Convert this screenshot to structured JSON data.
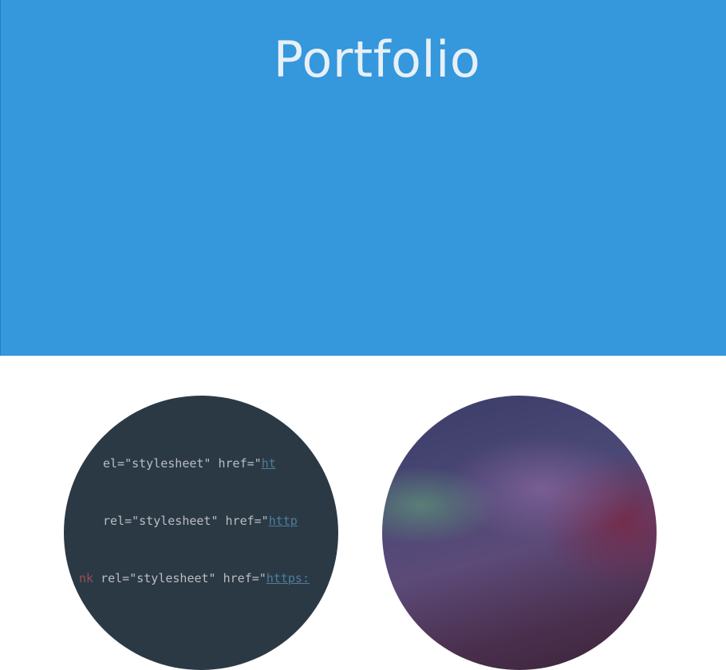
{
  "header": {
    "title": "Portfolio",
    "background_color": "#3597dc",
    "title_color": "#e6f0f7"
  },
  "portfolio": {
    "items": [
      {
        "kind": "code-snippet-thumbnail",
        "code_lines": [
          {
            "tag": "",
            "attr": "el=\"stylesheet\" href=\"",
            "url": "ht"
          },
          {
            "tag": "",
            "attr": "rel=\"stylesheet\" href=\"",
            "url": "http"
          },
          {
            "tag": "nk ",
            "attr": "rel=\"stylesheet\" href=\"",
            "url": "https:"
          }
        ]
      },
      {
        "kind": "aurora-image-thumbnail"
      }
    ]
  },
  "colors": {
    "accent": "#3597dc",
    "code_background": "#2b3945",
    "code_tag": "#9a4d58",
    "code_url": "#4d7f9a"
  }
}
